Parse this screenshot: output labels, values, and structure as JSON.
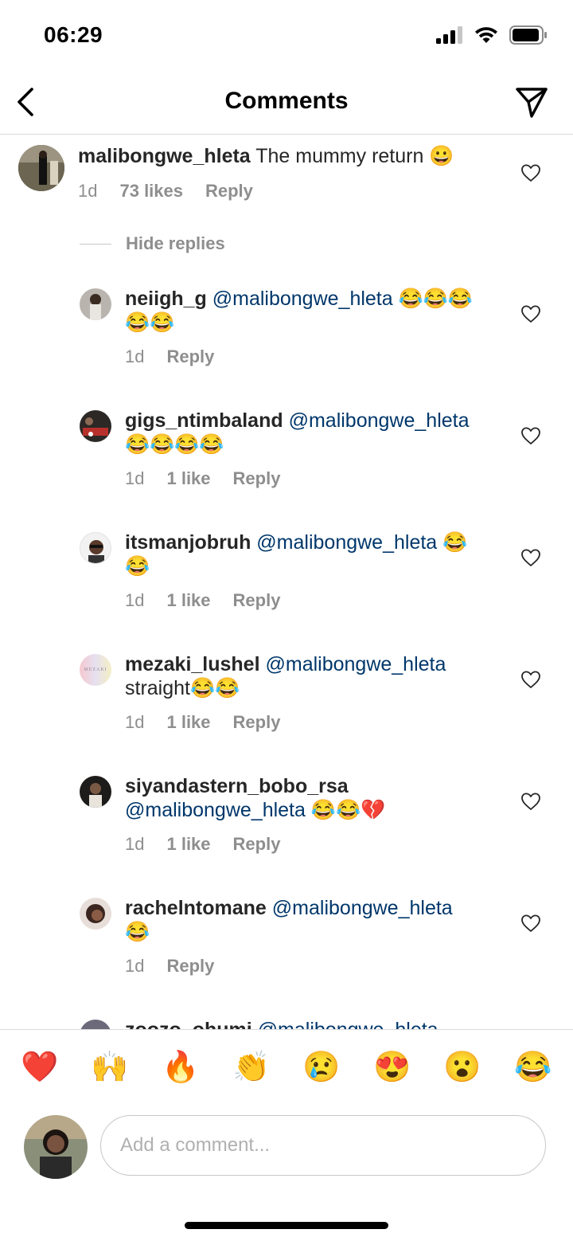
{
  "status": {
    "time": "06:29"
  },
  "header": {
    "title": "Comments"
  },
  "main_comment": {
    "username": "malibongwe_hleta",
    "text": "The mummy return 😀",
    "age": "1d",
    "likes": "73 likes",
    "reply": "Reply"
  },
  "hide_replies": "Hide replies",
  "replies": [
    {
      "username": "neiigh_g",
      "mention": "@malibongwe_hleta",
      "text": " 😂😂😂😂😂",
      "age": "1d",
      "likes": "",
      "reply": "Reply"
    },
    {
      "username": "gigs_ntimbaland",
      "mention": "@malibongwe_hleta",
      "text": " 😂😂😂😂",
      "age": "1d",
      "likes": "1 like",
      "reply": "Reply"
    },
    {
      "username": "itsmanjobruh",
      "mention": "@malibongwe_hleta",
      "text": " 😂😂",
      "age": "1d",
      "likes": "1 like",
      "reply": "Reply"
    },
    {
      "username": "mezaki_lushel",
      "mention": "@malibongwe_hleta",
      "text": " straight😂😂",
      "age": "1d",
      "likes": "1 like",
      "reply": "Reply"
    },
    {
      "username": "siyandastern_bobo_rsa",
      "mention": "@malibongwe_hleta",
      "text": " 😂😂💔",
      "age": "1d",
      "likes": "1 like",
      "reply": "Reply"
    },
    {
      "username": "rachelntomane",
      "mention": "@malibongwe_hleta",
      "text": " 😂",
      "age": "1d",
      "likes": "",
      "reply": "Reply"
    },
    {
      "username": "zoozo_ohumi",
      "mention": "@malibongwe_hleta",
      "text": "",
      "age": "",
      "likes": "",
      "reply": ""
    }
  ],
  "avatar_text": {
    "mezaki": "MEZAKI"
  },
  "emoji_bar": [
    "❤️",
    "🙌",
    "🔥",
    "👏",
    "😢",
    "😍",
    "😮",
    "😂"
  ],
  "composer": {
    "placeholder": "Add a comment..."
  },
  "colors": {
    "mention": "#00376b",
    "meta": "#8e8e8e",
    "text": "#262626"
  }
}
